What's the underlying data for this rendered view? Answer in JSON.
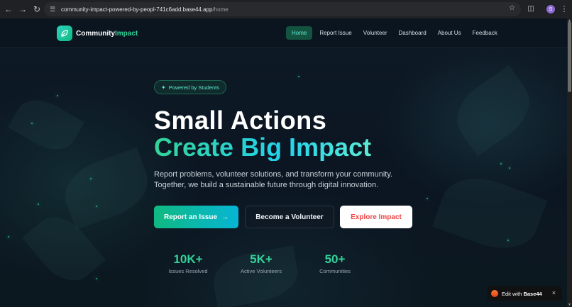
{
  "browser": {
    "url_host": "community-impact-powered-by-peopl-741c6add.base44.app",
    "url_path": "/home",
    "profile_initial": "S"
  },
  "site": {
    "logo_primary": "Community",
    "logo_accent": "Impact",
    "nav": [
      {
        "label": "Home",
        "active": true
      },
      {
        "label": "Report Issue",
        "active": false
      },
      {
        "label": "Volunteer",
        "active": false
      },
      {
        "label": "Dashboard",
        "active": false
      },
      {
        "label": "About Us",
        "active": false
      },
      {
        "label": "Feedback",
        "active": false
      }
    ]
  },
  "hero": {
    "badge": "Powered by Students",
    "title_line1": "Small Actions",
    "title_line2": "Create Big Impact",
    "subtitle": "Report problems, volunteer solutions, and transform your community. Together, we build a sustainable future through digital innovation.",
    "buttons": {
      "report": "Report an Issue",
      "volunteer": "Become a Volunteer",
      "explore": "Explore Impact"
    }
  },
  "stats": [
    {
      "value": "10K+",
      "label": "Issues Resolved"
    },
    {
      "value": "5K+",
      "label": "Active Volunteers"
    },
    {
      "value": "50+",
      "label": "Communities"
    }
  ],
  "edit_badge": {
    "prefix": "Edit with",
    "brand": "Base44",
    "close": "×"
  },
  "colors": {
    "accent": "#34d399",
    "cta_gradient_start": "#10b981",
    "cta_gradient_end": "#06b6d4",
    "explore_text": "#ef4444"
  }
}
